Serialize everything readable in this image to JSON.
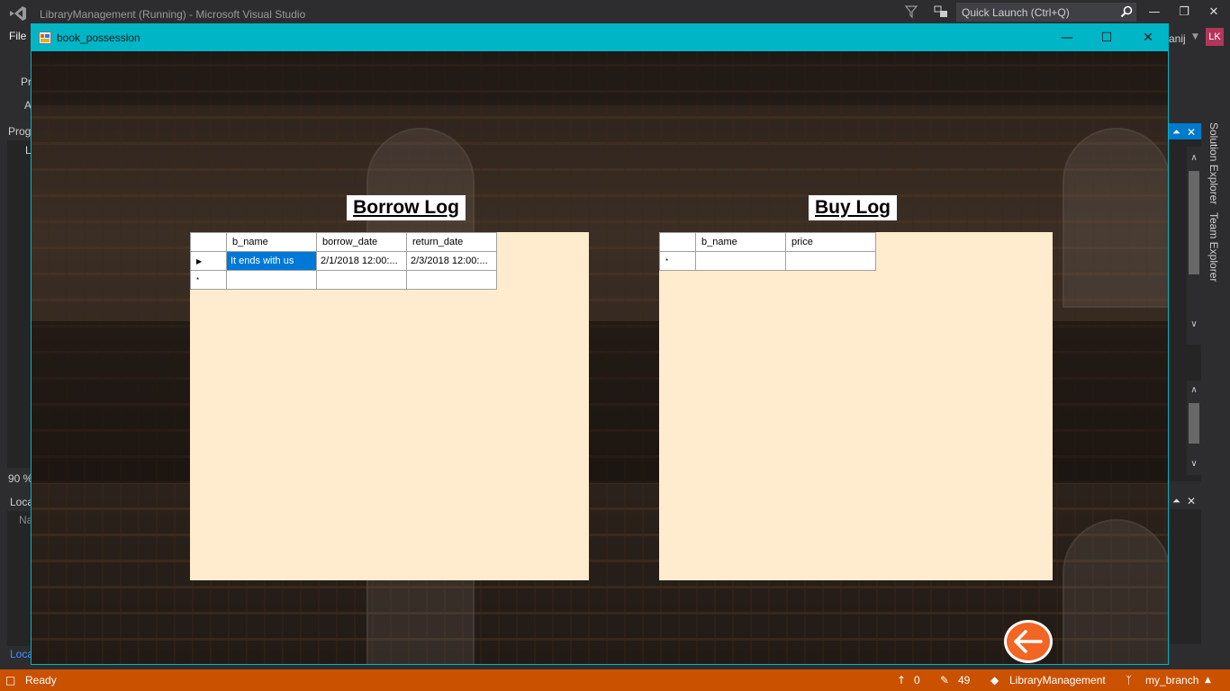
{
  "vs": {
    "title": "LibraryManagement (Running) - Microsoft Visual Studio",
    "quick_launch": "Quick Launch (Ctrl+Q)",
    "menu_file": "File",
    "user_name": "anij",
    "user_initials": "LK",
    "left_labels": [
      "Pr",
      "A",
      "Prog",
      "L",
      "90 %",
      "Loca",
      "Na",
      "Loca"
    ],
    "right_tabs": [
      "Solution Explorer",
      "Team Explorer"
    ]
  },
  "status": {
    "ready": "Ready",
    "arrow_count": "0",
    "pencil_count": "49",
    "repo": "LibraryManagement",
    "branch": "my_branch"
  },
  "form": {
    "title": "book_possession",
    "borrow_heading": "Borrow Log",
    "buy_heading": "Buy Log",
    "borrow_grid": {
      "columns": [
        "b_name",
        "borrow_date",
        "return_date"
      ],
      "rows": [
        [
          "It ends with us",
          "2/1/2018 12:00:...",
          "2/3/2018 12:00:..."
        ]
      ],
      "new_row_marker": "*"
    },
    "buy_grid": {
      "columns": [
        "b_name",
        "price"
      ],
      "new_row_marker": "*"
    },
    "back_button": "back-arrow-icon"
  },
  "colors": {
    "form_accent": "#00b5c6",
    "grid_background": "#ffebcd",
    "selection": "#0078d7",
    "status_bar": "#ca5100",
    "back_button": "#f26522"
  }
}
